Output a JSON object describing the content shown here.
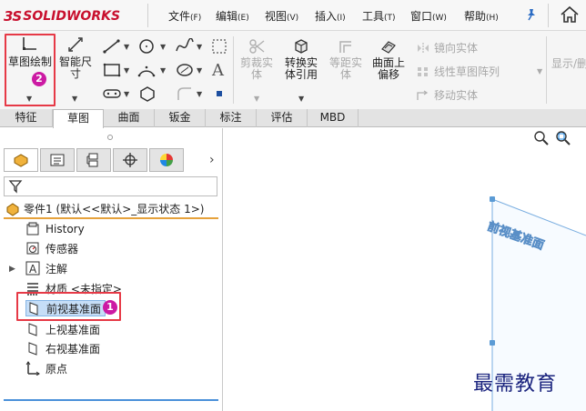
{
  "app": {
    "logo_text": "SOLIDWORKS",
    "logo_prefix": "3S",
    "brand_color": "#c8102e"
  },
  "menu": {
    "items": [
      {
        "label": "文件",
        "key": "(F)"
      },
      {
        "label": "编辑",
        "key": "(E)"
      },
      {
        "label": "视图",
        "key": "(V)"
      },
      {
        "label": "插入",
        "key": "(I)"
      },
      {
        "label": "工具",
        "key": "(T)"
      },
      {
        "label": "窗口",
        "key": "(W)"
      },
      {
        "label": "帮助",
        "key": "(H)"
      }
    ]
  },
  "ribbon": {
    "sketch_button": "草图绘制",
    "smart_dim_button": "智能尺寸",
    "trim_button": "剪裁实体",
    "convert_button": "转换实体引用",
    "offset_button": "等距实体",
    "offset_surface_button": "曲面上偏移",
    "mirror_button": "镜向实体",
    "linear_pattern_button": "线性草图阵列",
    "move_button": "移动实体",
    "show_relations_button": "显示/删除几何关系"
  },
  "annotations": {
    "step1": "1",
    "step2": "2",
    "highlight_color": "#e63946",
    "badge_color": "#cc1aa3"
  },
  "tabs": [
    "特征",
    "草图",
    "曲面",
    "钣金",
    "标注",
    "评估",
    "MBD"
  ],
  "active_tab": "草图",
  "tree": {
    "root_label": "零件1 (默认<<默认>_显示状态 1>)",
    "items": [
      {
        "label": "History",
        "icon": "history-icon"
      },
      {
        "label": "传感器",
        "icon": "sensor-icon"
      },
      {
        "label": "注解",
        "icon": "annotation-icon"
      },
      {
        "label": "材质 <未指定>",
        "icon": "material-icon"
      },
      {
        "label": "前视基准面",
        "icon": "plane-icon"
      },
      {
        "label": "上视基准面",
        "icon": "plane-icon"
      },
      {
        "label": "右视基准面",
        "icon": "plane-icon"
      },
      {
        "label": "原点",
        "icon": "origin-icon"
      }
    ]
  },
  "graphics": {
    "plane_label": "前视基准面",
    "watermark": "最需教育"
  }
}
